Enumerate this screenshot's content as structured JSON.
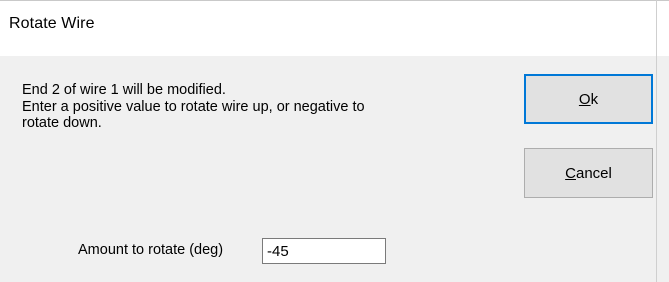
{
  "dialog": {
    "title": "Rotate Wire",
    "message_lines": [
      "End 2 of wire 1 will be modified.",
      "Enter a positive value to rotate wire up, or negative to",
      "rotate down."
    ],
    "ok_button": {
      "accesskey": "O",
      "rest": "k"
    },
    "cancel_button": {
      "accesskey": "C",
      "rest": "ancel"
    },
    "amount_label": "Amount to rotate (deg)",
    "amount_value": "-45"
  },
  "colors": {
    "client_background": "#f0f0f0",
    "button_face": "#e1e1e1",
    "default_button_border": "#0078d7"
  }
}
